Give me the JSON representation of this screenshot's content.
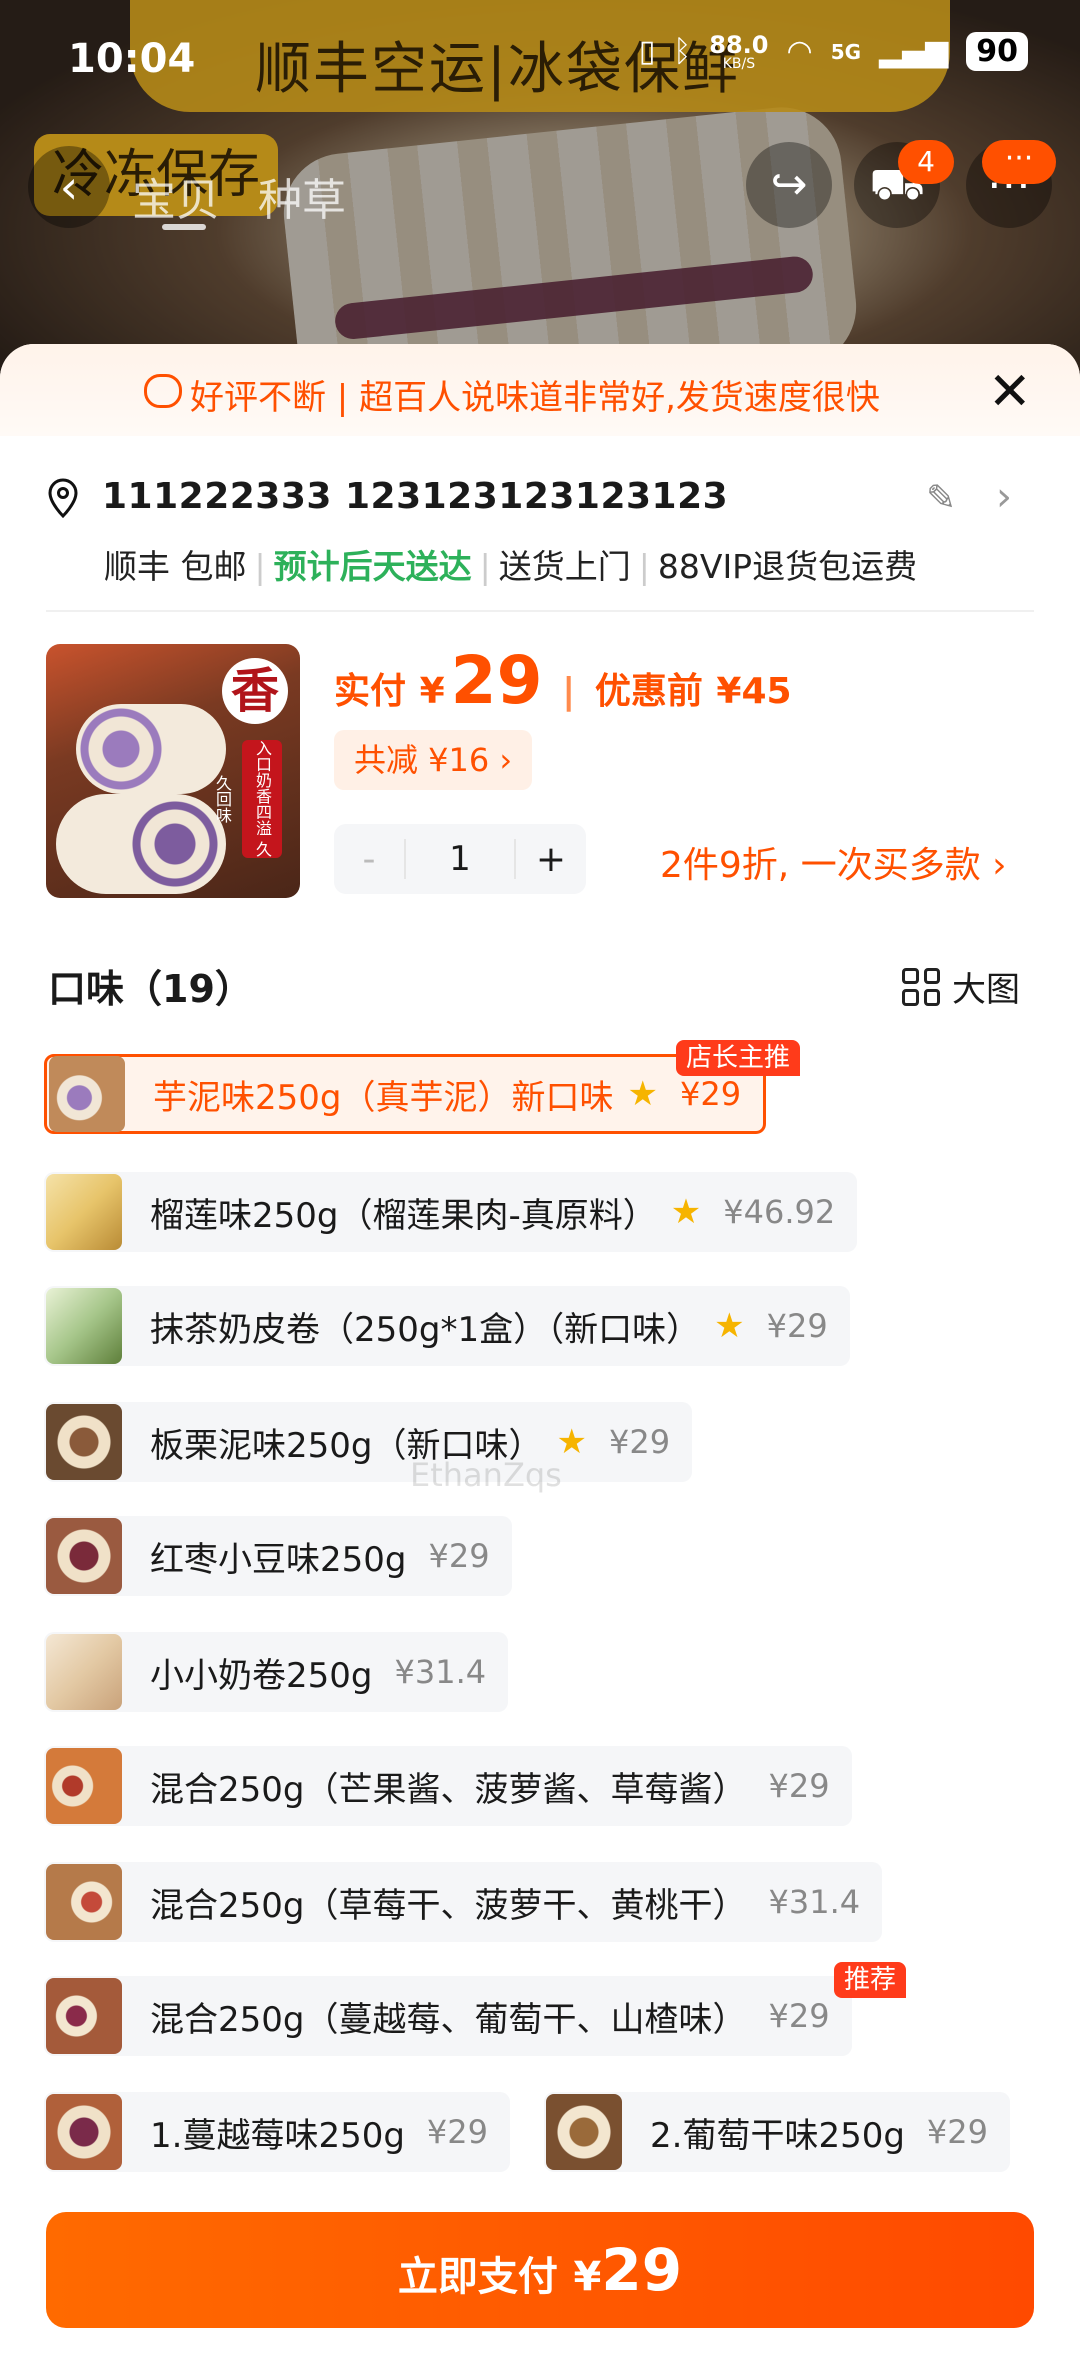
{
  "status_bar": {
    "time": "10:04",
    "net_speed": "88.0",
    "net_unit": "KB/S",
    "signal": "5G",
    "battery": "90"
  },
  "hero": {
    "banner": "顺丰空运|冰袋保鲜",
    "cold_tag": "冷冻保存"
  },
  "nav": {
    "tabs": [
      "宝贝",
      "种草"
    ],
    "cart_count": "4",
    "more_badge": "···"
  },
  "praise_banner": "好评不断 | 超百人说味道非常好,发货速度很快",
  "address": {
    "text": "111222333 123123123123123",
    "carrier": "顺丰 包邮",
    "eta": "预计后天送达",
    "delivery": "送货上门",
    "vip": "88VIP退货包运费"
  },
  "product": {
    "thumb_char": "香",
    "thumb_stamp": "入口奶香四溢 久久回味",
    "pay_label": "实付",
    "currency": "¥",
    "price": "29",
    "orig_label": "优惠前",
    "orig_price": "¥45",
    "discount": "共减 ¥16 ›",
    "quantity": "1",
    "minus": "-",
    "plus": "+",
    "promo": "2件9折, 一次买多款 ›"
  },
  "flavors": {
    "title": "口味（19）",
    "bigview_label": "大图",
    "options": [
      {
        "name": "芋泥味250g（真芋泥）新口味",
        "price": "¥29",
        "star": true,
        "selected": true,
        "badge": "店长主推"
      },
      {
        "name": "榴莲味250g（榴莲果肉-真原料）",
        "price": "¥46.92",
        "star": true
      },
      {
        "name": "抹茶奶皮卷（250g*1盒）（新口味）",
        "price": "¥29",
        "star": true
      },
      {
        "name": "板栗泥味250g（新口味）",
        "price": "¥29",
        "star": true
      },
      {
        "name": "红枣小豆味250g",
        "price": "¥29"
      },
      {
        "name": "小小奶卷250g",
        "price": "¥31.4"
      },
      {
        "name": "混合250g（芒果酱、菠萝酱、草莓酱）",
        "price": "¥29"
      },
      {
        "name": "混合250g（草莓干、菠萝干、黄桃干）",
        "price": "¥31.4"
      },
      {
        "name": "混合250g（蔓越莓、葡萄干、山楂味）",
        "price": "¥29",
        "badge": "推荐"
      },
      {
        "name": "1.蔓越莓味250g",
        "price": "¥29"
      },
      {
        "name": "2.葡萄干味250g",
        "price": "¥29"
      }
    ]
  },
  "watermark": "EthanZqs",
  "pay_button": {
    "label": "立即支付",
    "currency": "¥",
    "amount": "29"
  }
}
